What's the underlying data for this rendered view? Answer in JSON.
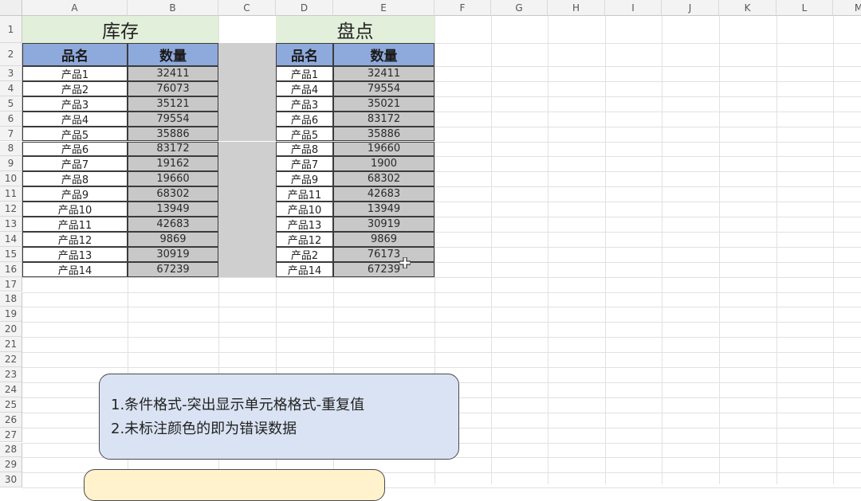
{
  "columns": [
    "A",
    "B",
    "C",
    "D",
    "E",
    "F",
    "G",
    "H",
    "I",
    "J",
    "K",
    "L",
    "M"
  ],
  "rows": [
    "1",
    "2",
    "3",
    "4",
    "5",
    "6",
    "7",
    "8",
    "9",
    "10",
    "11",
    "12",
    "13",
    "14",
    "15",
    "16",
    "17",
    "18",
    "19",
    "20",
    "21",
    "22",
    "23",
    "24",
    "25",
    "26",
    "27",
    "28",
    "29",
    "30"
  ],
  "inventory": {
    "title": "库存",
    "header_name": "品名",
    "header_qty": "数量",
    "items": [
      {
        "name": "产品1",
        "qty": "32411"
      },
      {
        "name": "产品2",
        "qty": "76073"
      },
      {
        "name": "产品3",
        "qty": "35121"
      },
      {
        "name": "产品4",
        "qty": "79554"
      },
      {
        "name": "产品5",
        "qty": "35886"
      },
      {
        "name": "产品6",
        "qty": "83172"
      },
      {
        "name": "产品7",
        "qty": "19162"
      },
      {
        "name": "产品8",
        "qty": "19660"
      },
      {
        "name": "产品9",
        "qty": "68302"
      },
      {
        "name": "产品10",
        "qty": "13949"
      },
      {
        "name": "产品11",
        "qty": "42683"
      },
      {
        "name": "产品12",
        "qty": "9869"
      },
      {
        "name": "产品13",
        "qty": "30919"
      },
      {
        "name": "产品14",
        "qty": "67239"
      }
    ]
  },
  "stocktake": {
    "title": "盘点",
    "header_name": "品名",
    "header_qty": "数量",
    "items": [
      {
        "name": "产品1",
        "qty": "32411"
      },
      {
        "name": "产品4",
        "qty": "79554"
      },
      {
        "name": "产品3",
        "qty": "35021"
      },
      {
        "name": "产品6",
        "qty": "83172"
      },
      {
        "name": "产品5",
        "qty": "35886"
      },
      {
        "name": "产品8",
        "qty": "19660"
      },
      {
        "name": "产品7",
        "qty": "1900"
      },
      {
        "name": "产品9",
        "qty": "68302"
      },
      {
        "name": "产品11",
        "qty": "42683"
      },
      {
        "name": "产品10",
        "qty": "13949"
      },
      {
        "name": "产品13",
        "qty": "30919"
      },
      {
        "name": "产品12",
        "qty": "9869"
      },
      {
        "name": "产品2",
        "qty": "76173"
      },
      {
        "name": "产品14",
        "qty": "67239"
      }
    ]
  },
  "note": {
    "line1": "1.条件格式-突出显示单元格格式-重复值",
    "line2": "2.未标注颜色的即为错误数据"
  },
  "colors": {
    "title_bg": "#e2efda",
    "header_bg": "#8ea9db",
    "duplicate_bg": "#c8c8c8",
    "note_bg": "#dae3f3",
    "note2_bg": "#fff2cc"
  }
}
